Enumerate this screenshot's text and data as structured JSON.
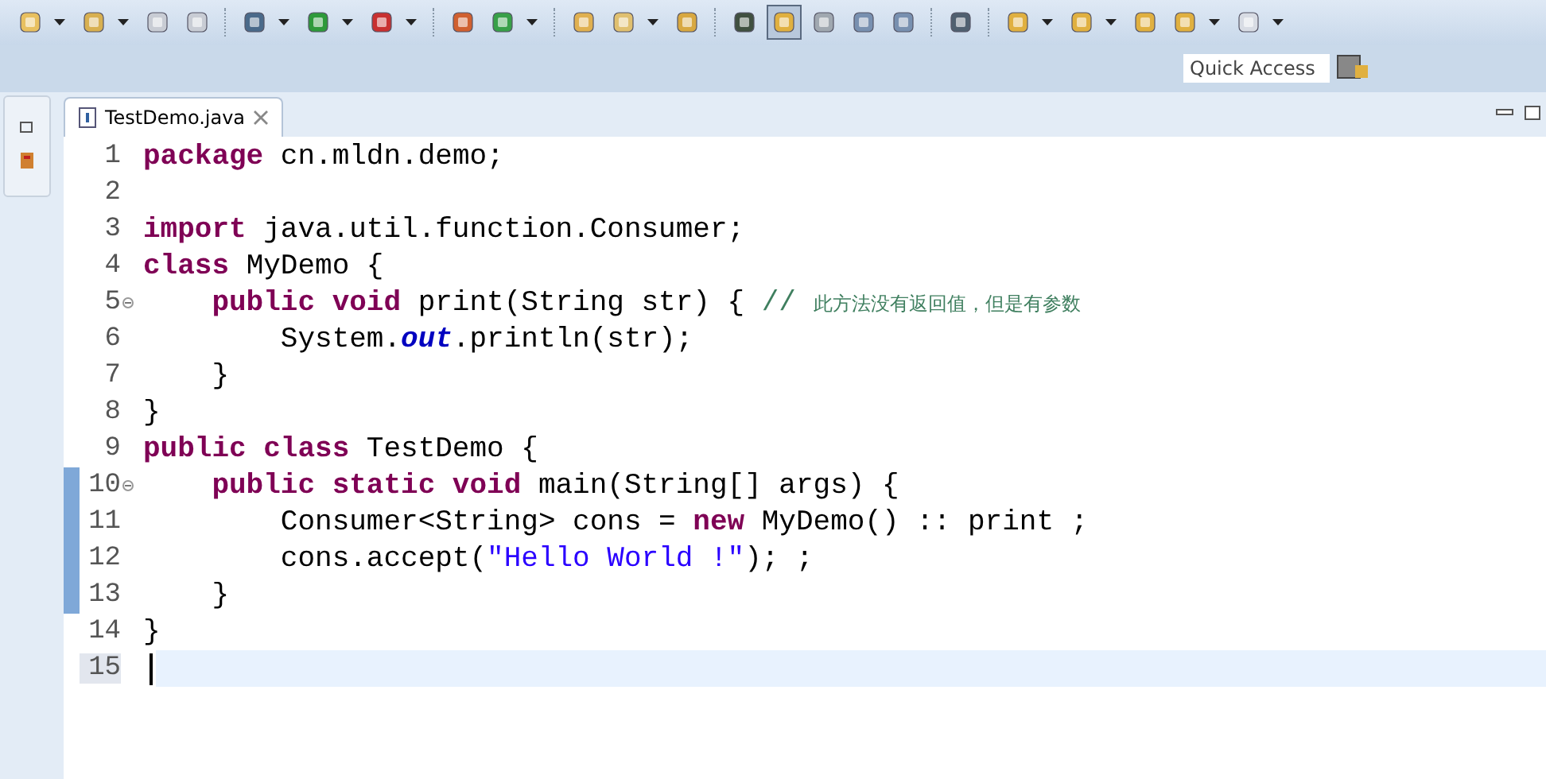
{
  "toolbar": {
    "quick_access": {
      "placeholder": "Quick Access"
    }
  },
  "editor": {
    "tabs": [
      {
        "label": "TestDemo.java",
        "selected": true
      }
    ],
    "lines": [
      {
        "number": "1",
        "changed": false,
        "current": false,
        "foldable": false,
        "tokens": [
          {
            "kind": "keyword",
            "text": "package"
          },
          {
            "kind": "plain",
            "text": " cn.mldn.demo;"
          }
        ]
      },
      {
        "number": "2",
        "changed": false,
        "current": false,
        "foldable": false
      },
      {
        "number": "3",
        "changed": false,
        "current": false,
        "foldable": false,
        "tokens": [
          {
            "kind": "keyword",
            "text": "import"
          },
          {
            "kind": "plain",
            "text": " java.util.function.Consumer;"
          }
        ]
      },
      {
        "number": "4",
        "changed": false,
        "current": false,
        "foldable": false,
        "tokens": [
          {
            "kind": "keyword",
            "text": "class"
          },
          {
            "kind": "plain",
            "text": " MyDemo {"
          }
        ]
      },
      {
        "number": "5",
        "changed": false,
        "current": false,
        "foldable": true,
        "tokens": [
          {
            "kind": "keyword",
            "text": "    public void"
          },
          {
            "kind": "plain",
            "text": " print(String str) { "
          },
          {
            "kind": "comment",
            "text": "// "
          },
          {
            "kind": "note",
            "text": "此方法没有返回值，但是有参数"
          }
        ]
      },
      {
        "number": "6",
        "changed": false,
        "current": false,
        "foldable": false,
        "tokens": [
          {
            "kind": "plain",
            "text": "        System."
          },
          {
            "kind": "field",
            "text": "out"
          },
          {
            "kind": "plain",
            "text": ".println(str);"
          }
        ]
      },
      {
        "number": "7",
        "changed": false,
        "current": false,
        "foldable": false,
        "tokens": [
          {
            "kind": "plain",
            "text": "    }"
          }
        ]
      },
      {
        "number": "8",
        "changed": false,
        "current": false,
        "foldable": false,
        "tokens": [
          {
            "kind": "plain",
            "text": "}"
          }
        ]
      },
      {
        "number": "9",
        "changed": false,
        "current": false,
        "foldable": false,
        "tokens": [
          {
            "kind": "keyword",
            "text": "public class"
          },
          {
            "kind": "plain",
            "text": " TestDemo {"
          }
        ]
      },
      {
        "number": "10",
        "changed": true,
        "current": false,
        "foldable": true,
        "tokens": [
          {
            "kind": "keyword",
            "text": "    public static void"
          },
          {
            "kind": "plain",
            "text": " main(String[] args) {"
          }
        ]
      },
      {
        "number": "11",
        "changed": true,
        "current": false,
        "foldable": false,
        "tokens": [
          {
            "kind": "plain",
            "text": "        Consumer<String> cons = "
          },
          {
            "kind": "keyword",
            "text": "new"
          },
          {
            "kind": "plain",
            "text": " MyDemo() :: print ;"
          }
        ]
      },
      {
        "number": "12",
        "changed": true,
        "current": false,
        "foldable": false,
        "tokens": [
          {
            "kind": "plain",
            "text": "        cons.accept("
          },
          {
            "kind": "string",
            "text": "\"Hello World !\""
          },
          {
            "kind": "plain",
            "text": "); ;"
          }
        ]
      },
      {
        "number": "13",
        "changed": true,
        "current": false,
        "foldable": false,
        "tokens": [
          {
            "kind": "plain",
            "text": "    }"
          }
        ]
      },
      {
        "number": "14",
        "changed": false,
        "current": false,
        "foldable": false,
        "tokens": [
          {
            "kind": "plain",
            "text": "}"
          }
        ]
      },
      {
        "number": "15",
        "changed": false,
        "current": true,
        "foldable": false
      }
    ]
  }
}
